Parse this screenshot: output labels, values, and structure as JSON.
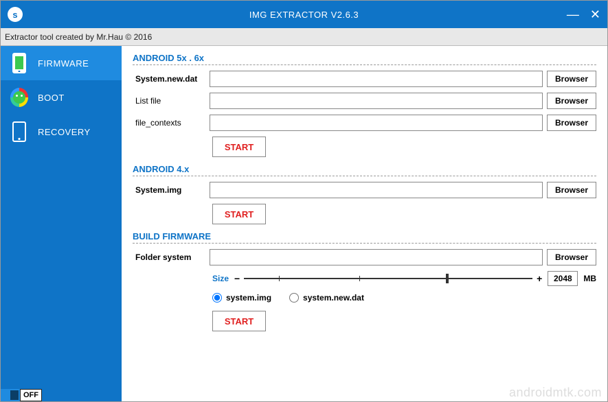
{
  "titlebar": {
    "logo": "s",
    "title": "IMG EXTRACTOR V2.6.3"
  },
  "subheader": "Extractor tool created by Mr.Hau © 2016",
  "sidebar": {
    "items": [
      {
        "label": "FIRMWARE"
      },
      {
        "label": "BOOT"
      },
      {
        "label": "RECOVERY"
      }
    ]
  },
  "sections": {
    "a56": {
      "title": "ANDROID 5x . 6x",
      "rows": [
        {
          "label": "System.new.dat",
          "bold": true,
          "value": "",
          "btn": "Browser"
        },
        {
          "label": "List file",
          "bold": false,
          "value": "",
          "btn": "Browser"
        },
        {
          "label": "file_contexts",
          "bold": false,
          "value": "",
          "btn": "Browser"
        }
      ],
      "start": "START"
    },
    "a4": {
      "title": "ANDROID 4.x",
      "rows": [
        {
          "label": "System.img",
          "bold": true,
          "value": "",
          "btn": "Browser"
        }
      ],
      "start": "START"
    },
    "build": {
      "title": "BUILD FIRMWARE",
      "rows": [
        {
          "label": "Folder system",
          "bold": true,
          "value": "",
          "btn": "Browser"
        }
      ],
      "size": {
        "label": "Size",
        "value": "2048",
        "unit": "MB"
      },
      "radios": [
        {
          "label": "system.img",
          "checked": true
        },
        {
          "label": "system.new.dat",
          "checked": false
        }
      ],
      "start": "START"
    }
  },
  "toggle": {
    "label": "OFF"
  },
  "watermark": "androidmtk.com"
}
